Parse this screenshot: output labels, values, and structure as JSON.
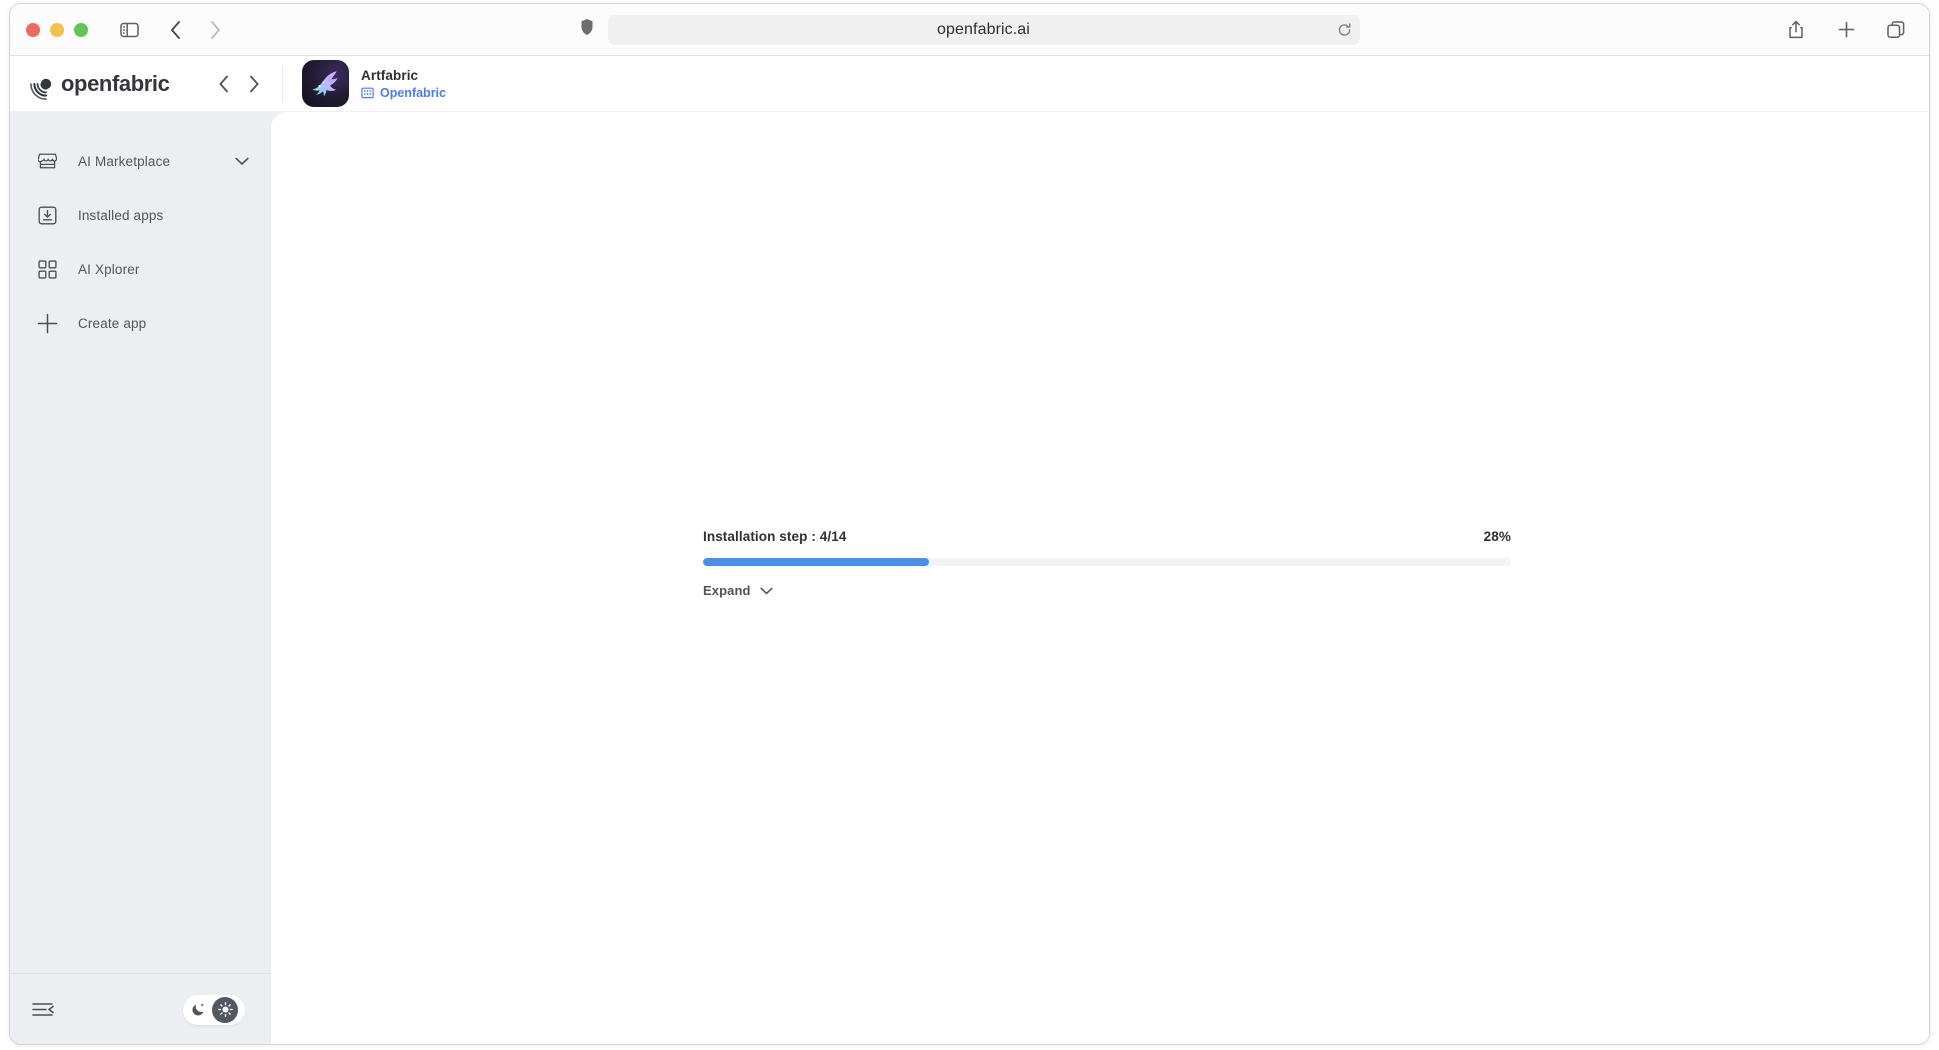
{
  "browser": {
    "url": "openfabric.ai",
    "traffic_lights": [
      "close",
      "minimize",
      "maximize"
    ],
    "icons": {
      "sidebar_toggle": "sidebar-toggle-icon",
      "back": "back-arrow-icon",
      "forward": "forward-arrow-icon",
      "shield": "privacy-shield-icon",
      "reload": "reload-icon",
      "share": "share-icon",
      "new_tab": "plus-icon",
      "tab_overview": "tab-overview-icon"
    }
  },
  "app_header": {
    "brand_name": "openfabric",
    "nav": {
      "prev": "chevron-left-icon",
      "next": "chevron-right-icon"
    },
    "app": {
      "title": "Artfabric",
      "publisher": "Openfabric",
      "publisher_icon": "company-building-icon",
      "thumb_icon": "hummingbird-icon"
    }
  },
  "sidebar": {
    "items": [
      {
        "label": "AI Marketplace",
        "icon": "marketplace-icon",
        "has_chevron": true
      },
      {
        "label": "Installed apps",
        "icon": "download-box-icon",
        "has_chevron": false
      },
      {
        "label": "AI Xplorer",
        "icon": "grid-squares-icon",
        "has_chevron": false
      },
      {
        "label": "Create app",
        "icon": "plus-icon",
        "has_chevron": false
      }
    ],
    "footer": {
      "collapse_icon": "collapse-sidebar-icon",
      "theme": {
        "dark_icon": "moon-icon",
        "light_icon": "sun-icon",
        "active": "light"
      }
    }
  },
  "content": {
    "install": {
      "step_label": "Installation step : 4/14",
      "percent_label": "28%",
      "percent_value": 28,
      "expand_label": "Expand",
      "expand_icon": "chevron-down-icon",
      "bar_color": "#4a90e6"
    }
  }
}
